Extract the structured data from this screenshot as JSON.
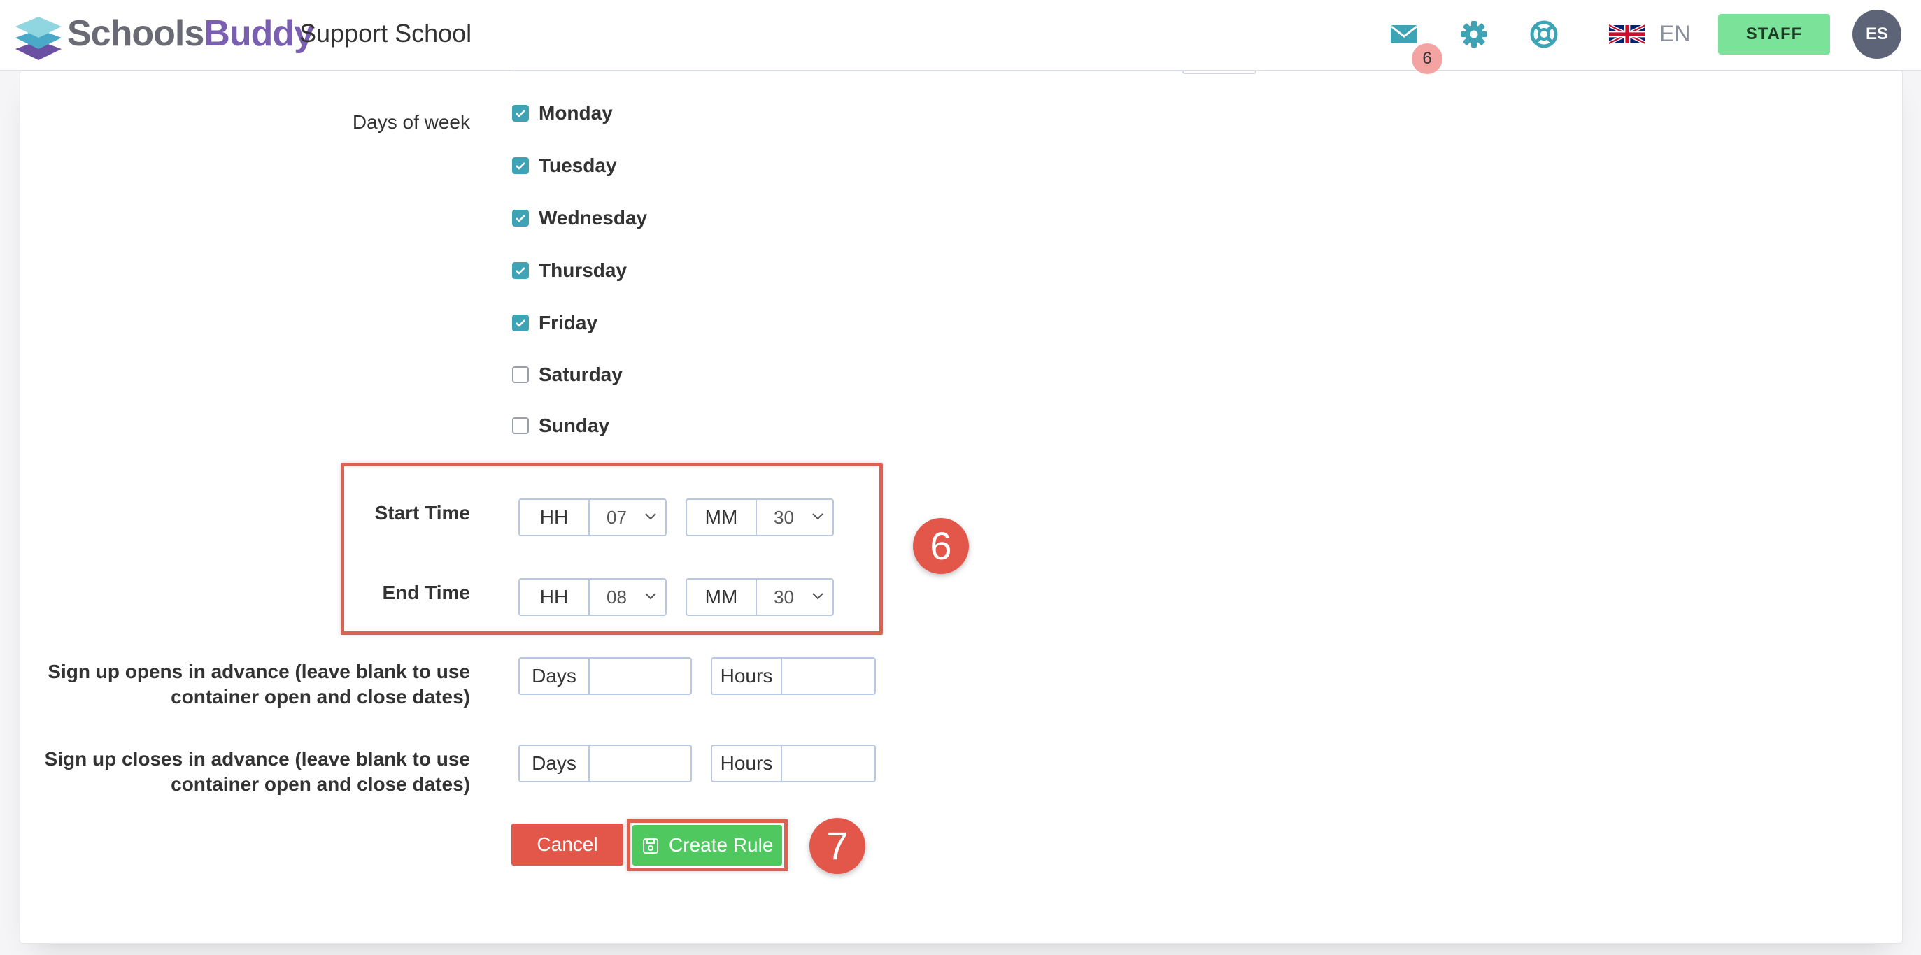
{
  "header": {
    "logo": {
      "part1": "Schools",
      "part2": "Buddy"
    },
    "school_name": "Support School",
    "mail_badge": "6",
    "language": "EN",
    "staff_label": "STAFF",
    "avatar_initials": "ES",
    "icons": [
      "mail-icon",
      "gear-icon",
      "lifebuoy-icon",
      "uk-flag-icon"
    ]
  },
  "form": {
    "days_label": "Days of week",
    "days": [
      {
        "label": "Monday",
        "checked": true
      },
      {
        "label": "Tuesday",
        "checked": true
      },
      {
        "label": "Wednesday",
        "checked": true
      },
      {
        "label": "Thursday",
        "checked": true
      },
      {
        "label": "Friday",
        "checked": true
      },
      {
        "label": "Saturday",
        "checked": false
      },
      {
        "label": "Sunday",
        "checked": false
      }
    ],
    "start_time": {
      "label": "Start Time",
      "hh_label": "HH",
      "hh_value": "07",
      "mm_label": "MM",
      "mm_value": "30"
    },
    "end_time": {
      "label": "End Time",
      "hh_label": "HH",
      "hh_value": "08",
      "mm_label": "MM",
      "mm_value": "30"
    },
    "signup_opens": {
      "label_line1": "Sign up opens in advance (leave blank to use",
      "label_line2": "container open and close dates)",
      "days_label": "Days",
      "hours_label": "Hours"
    },
    "signup_closes": {
      "label_line1": "Sign up closes in advance (leave blank to use",
      "label_line2": "container open and close dates)",
      "days_label": "Days",
      "hours_label": "Hours"
    },
    "cancel_label": "Cancel",
    "create_label": "Create Rule"
  },
  "annotations": {
    "step_time": "6",
    "step_create": "7"
  },
  "colors": {
    "accent_teal": "#3ea3b4",
    "brand_purple": "#7a5fb0",
    "staff_green": "#7be29a",
    "create_green": "#4fc95f",
    "cancel_red": "#e2574a",
    "highlight_red": "#e06050",
    "badge_pink": "#f4a3a3"
  }
}
